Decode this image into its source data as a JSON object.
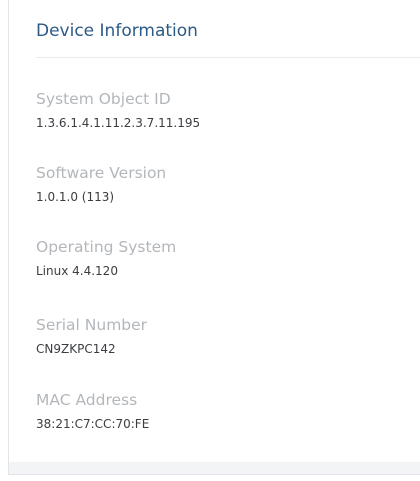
{
  "panel": {
    "title": "Device Information"
  },
  "fields": [
    {
      "label": "System Object ID",
      "value": "1.3.6.1.4.1.11.2.3.7.11.195"
    },
    {
      "label": "Software Version",
      "value": "1.0.1.0 (113)"
    },
    {
      "label": "Operating System",
      "value": "Linux 4.4.120"
    },
    {
      "label": "Serial Number",
      "value": "CN9ZKPC142"
    },
    {
      "label": "MAC Address",
      "value": "38:21:C7:CC:70:FE"
    }
  ],
  "colors": {
    "title": "#2c5a86",
    "label": "#b3b7bc",
    "value": "#3a3d41"
  }
}
